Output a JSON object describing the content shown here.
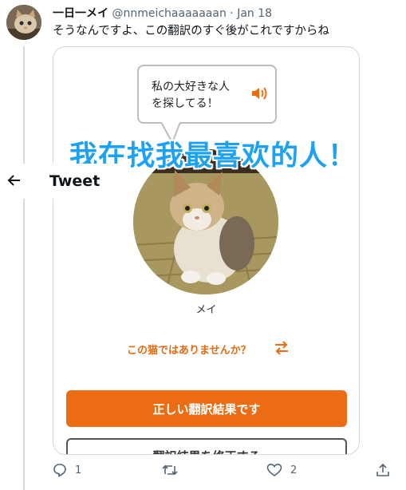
{
  "tweet": {
    "author_name": "一日一メイ",
    "handle": "@nnmeichaaaaaaan",
    "separator": "·",
    "date": "Jan 18",
    "text": "そうなんですよ、この翻訳のすぐ後がこれですからね",
    "avatar_icon": "avatar-cat-photo"
  },
  "media": {
    "speech_line_1": "私の大好きな人",
    "speech_line_2": "を探してる！",
    "speaker_icon": "speaker-icon",
    "overlay_caption": "我在找我最喜欢的人！",
    "cat_name": "メイ",
    "suggestion": "この猫ではありませんか？",
    "swap_icon": "swap-arrows-icon",
    "primary_button": "正しい翻訳結果です",
    "secondary_button": "翻訳結果を修正する",
    "accent_color": "#ec6c14",
    "overlay_color": "#1da1f2"
  },
  "topbar": {
    "back_icon": "back-arrow-icon",
    "title": "Tweet"
  },
  "actions": {
    "reply_count": "1",
    "retweet_count": "",
    "like_count": "2",
    "icons": [
      "reply-icon",
      "retweet-icon",
      "like-icon",
      "share-icon"
    ]
  }
}
